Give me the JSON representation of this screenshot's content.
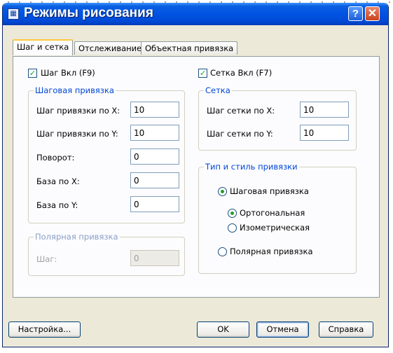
{
  "window": {
    "title": "Режимы рисования",
    "help_label": "?",
    "close_label": "✕"
  },
  "tabs": [
    {
      "label": "Шаг и сетка",
      "active": true
    },
    {
      "label": "Отслеживание",
      "active": false
    },
    {
      "label": "Объектная привязка",
      "active": false
    }
  ],
  "snap": {
    "enabled_label": "Шаг Вкл (F9)",
    "enabled": true,
    "group_title": "Шаговая привязка",
    "fields": [
      {
        "label": "Шаг привязки по X:",
        "value": "10"
      },
      {
        "label": "Шаг привязки по Y:",
        "value": "10"
      },
      {
        "label": "Поворот:",
        "value": "0"
      },
      {
        "label": "База по X:",
        "value": "0"
      },
      {
        "label": "База по Y:",
        "value": "0"
      }
    ]
  },
  "polar": {
    "group_title": "Полярная привязка",
    "step_label": "Шаг:",
    "step_value": "0"
  },
  "grid": {
    "enabled_label": "Сетка Вкл (F7)",
    "enabled": true,
    "group_title": "Сетка",
    "fields": [
      {
        "label": "Шаг сетки по X:",
        "value": "10"
      },
      {
        "label": "Шаг сетки по Y:",
        "value": "10"
      }
    ]
  },
  "snap_type": {
    "group_title": "Тип и стиль привязки",
    "grid_snap_label": "Шаговая привязка",
    "rectangular_label": "Ортогональная",
    "isometric_label": "Изометрическая",
    "polar_label": "Полярная привязка",
    "selected": "grid_snap",
    "style_selected": "rectangular"
  },
  "buttons": {
    "settings": "Настройка...",
    "ok": "OK",
    "cancel": "Отмена",
    "help": "Справка"
  }
}
